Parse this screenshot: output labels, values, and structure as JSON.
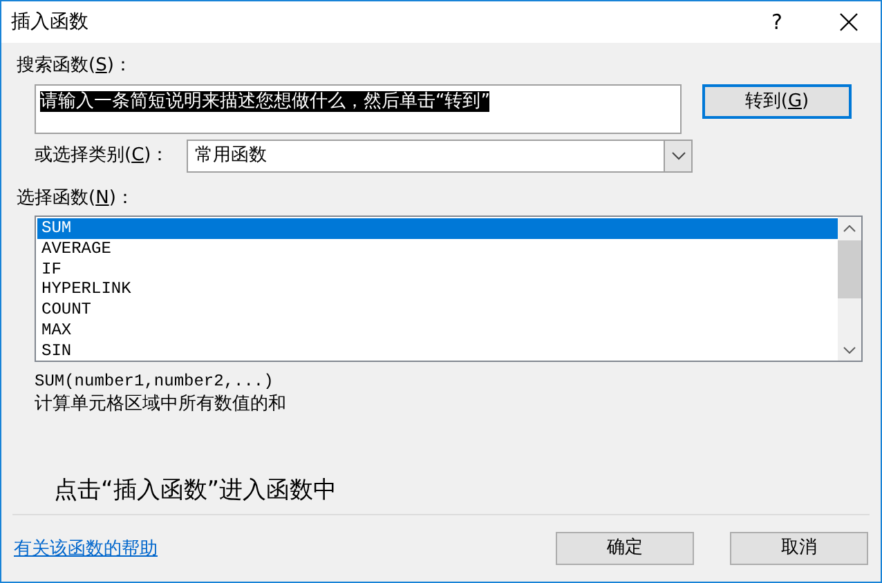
{
  "window": {
    "title": "插入函数",
    "help_button": "?"
  },
  "search": {
    "label": {
      "before": "搜索函数(",
      "key": "S",
      "after": ")："
    },
    "value": "请输入一条简短说明来描述您想做什么，然后单击“转到”",
    "value_selected": true,
    "go_button": {
      "before": "转到(",
      "key": "G",
      "after": ")"
    }
  },
  "category": {
    "label": {
      "before": "或选择类别(",
      "key": "C",
      "after": ")："
    },
    "value": "常用函数"
  },
  "function_list": {
    "label": {
      "before": "选择函数(",
      "key": "N",
      "after": ")："
    },
    "items": [
      {
        "name": "SUM",
        "selected": true
      },
      {
        "name": "AVERAGE",
        "selected": false
      },
      {
        "name": "IF",
        "selected": false
      },
      {
        "name": "HYPERLINK",
        "selected": false
      },
      {
        "name": "COUNT",
        "selected": false
      },
      {
        "name": "MAX",
        "selected": false
      },
      {
        "name": "SIN",
        "selected": false
      }
    ]
  },
  "signature": "SUM(number1,number2,...)",
  "description": "计算单元格区域中所有数值的和",
  "annotation": "点击“插入函数”进入函数中",
  "help_link": "有关该函数的帮助",
  "buttons": [
    {
      "label": "确定"
    },
    {
      "label": "取消"
    }
  ]
}
